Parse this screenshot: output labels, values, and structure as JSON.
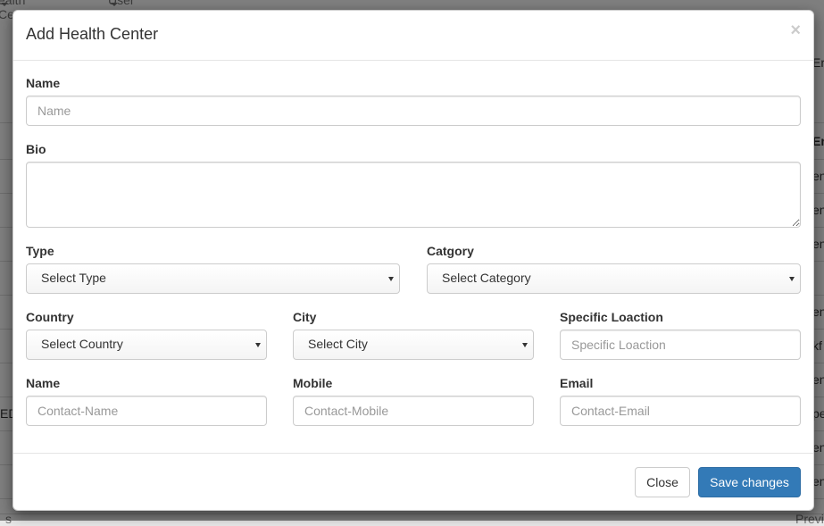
{
  "background": {
    "nav": [
      "ealth Center",
      "User Managment"
    ],
    "right_texts": [
      "Er",
      "Er",
      "en",
      "en",
      "en",
      "en",
      "kf",
      "en",
      "pe",
      "en",
      "en"
    ],
    "left_texts": [
      "ED"
    ],
    "bottom_left": "s",
    "bottom_right": "Previ"
  },
  "modal": {
    "title": "Add Health Center",
    "close_symbol": "×",
    "fields": {
      "name_label": "Name",
      "name_placeholder": "Name",
      "bio_label": "Bio",
      "type_label": "Type",
      "type_value": "Select Type",
      "category_label": "Catgory",
      "category_value": "Select Category",
      "country_label": "Country",
      "country_value": "Select Country",
      "city_label": "City",
      "city_value": "Select City",
      "location_label": "Specific Loaction",
      "location_placeholder": "Specific Loaction",
      "contact_name_label": "Name",
      "contact_name_placeholder": "Contact-Name",
      "mobile_label": "Mobile",
      "mobile_placeholder": "Contact-Mobile",
      "email_label": "Email",
      "email_placeholder": "Contact-Email"
    },
    "footer": {
      "close_label": "Close",
      "save_label": "Save changes"
    }
  }
}
